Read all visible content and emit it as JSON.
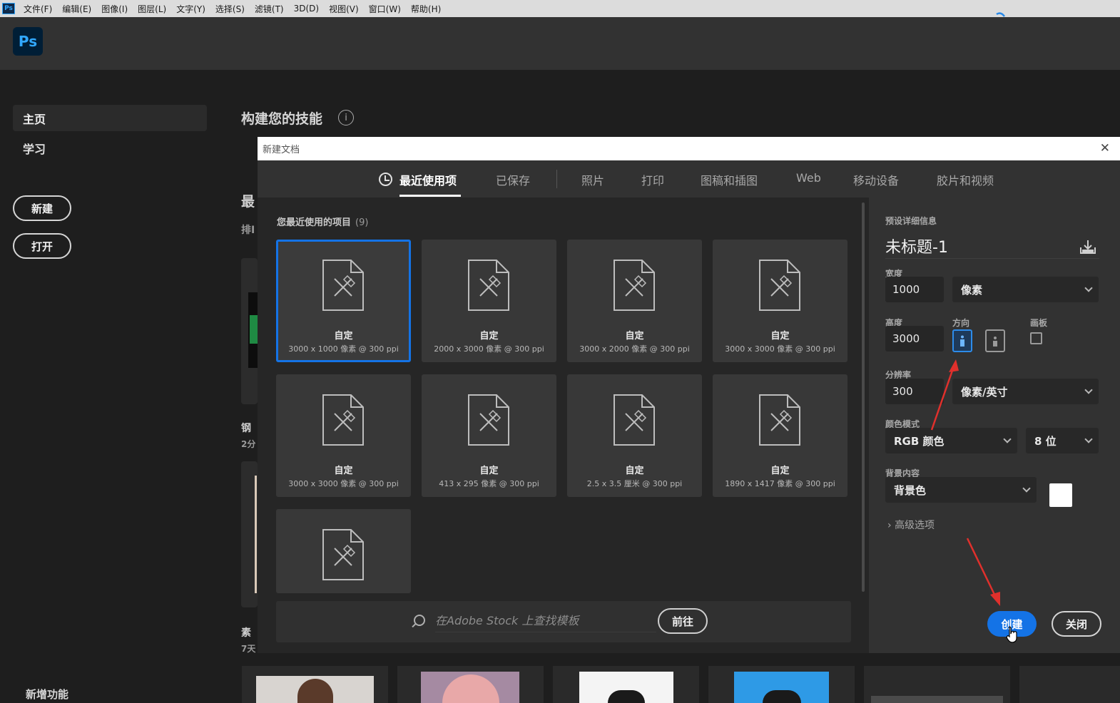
{
  "menu": [
    "文件(F)",
    "编辑(E)",
    "图像(I)",
    "图层(L)",
    "文字(Y)",
    "选择(S)",
    "滤镜(T)",
    "3D(D)",
    "视图(V)",
    "窗口(W)",
    "帮助(H)"
  ],
  "app": {
    "logo": "Ps",
    "menu_logo": "Ps"
  },
  "home": {
    "nav_home": "主页",
    "nav_learn": "学习",
    "new_button": "新建",
    "open_button": "打开",
    "whats_new": "新增功能",
    "build_skills": "构建您的技能",
    "info_icon": "i",
    "fragments": [
      "最",
      "排I",
      "钢",
      "2分",
      "素",
      "7天"
    ]
  },
  "dialog": {
    "title": "新建文档",
    "close_icon": "✕",
    "tabs": [
      {
        "label": "最近使用项",
        "active": true
      },
      {
        "label": "已保存"
      },
      {
        "label": "照片"
      },
      {
        "label": "打印"
      },
      {
        "label": "图稿和插图"
      },
      {
        "label": "Web"
      },
      {
        "label": "移动设备"
      },
      {
        "label": "胶片和视频"
      }
    ],
    "recent_label": "您最近使用的项目",
    "recent_count": "(9)",
    "presets": [
      {
        "name": "自定",
        "dims": "3000 x 1000 像素 @ 300 ppi",
        "selected": true
      },
      {
        "name": "自定",
        "dims": "2000 x 3000 像素 @ 300 ppi"
      },
      {
        "name": "自定",
        "dims": "3000 x 2000 像素 @ 300 ppi"
      },
      {
        "name": "自定",
        "dims": "3000 x 3000 像素 @ 300 ppi"
      },
      {
        "name": "自定",
        "dims": "3000 x 3000 像素 @ 300 ppi"
      },
      {
        "name": "自定",
        "dims": "413 x 295 像素 @ 300 ppi"
      },
      {
        "name": "自定",
        "dims": "2.5 x 3.5 厘米 @ 300 ppi"
      },
      {
        "name": "自定",
        "dims": "1890 x 1417 像素 @ 300 ppi"
      },
      {
        "name": "",
        "dims": ""
      }
    ],
    "stock": {
      "placeholder": "在Adobe Stock 上查找模板",
      "go": "前往"
    }
  },
  "preset_details": {
    "heading": "预设详细信息",
    "doc_name": "未标题-1",
    "width_label": "宽度",
    "width": "1000",
    "width_unit": "像素",
    "height_label": "高度",
    "height": "3000",
    "orientation_label": "方向",
    "orientation": "portrait",
    "artboard_label": "画板",
    "artboard_checked": false,
    "resolution_label": "分辨率",
    "resolution": "300",
    "resolution_unit": "像素/英寸",
    "color_mode_label": "颜色模式",
    "color_mode": "RGB 颜色",
    "bit_depth": "8 位",
    "background_label": "背景内容",
    "background": "背景色",
    "background_color": "#ffffff",
    "advanced": "高级选项",
    "create": "创建",
    "close": "关闭"
  },
  "colors": {
    "accent": "#1473e6",
    "annotation_arrow": "#e0302c"
  }
}
